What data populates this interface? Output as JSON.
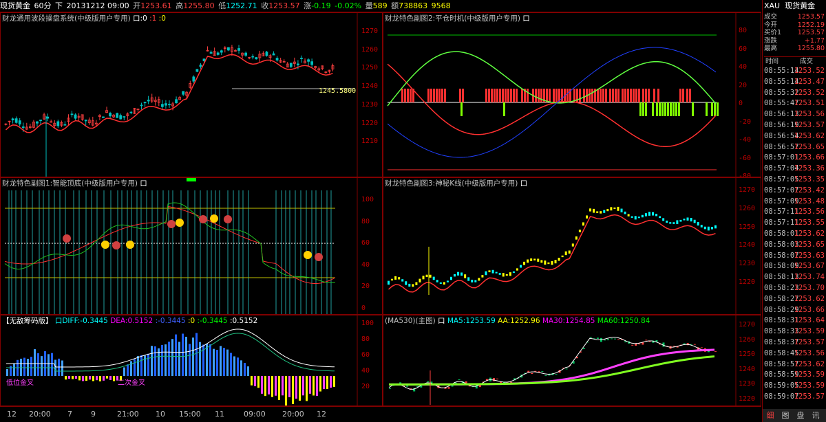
{
  "top": {
    "name": "现货黄金",
    "period": "60分",
    "mode": "下",
    "datetime": "20131212 09:00",
    "open_label": "开",
    "open": "1253.61",
    "high_label": "高",
    "high": "1255.80",
    "low_label": "低",
    "low": "1252.71",
    "close_label": "收",
    "close": "1253.57",
    "chg_label": "涨",
    "chg": "-0.19",
    "pct": "-0.02%",
    "vol_label": "量",
    "vol": "589",
    "amt_label": "额",
    "amt": "738863",
    "extra": "9568"
  },
  "panels": {
    "p1": {
      "title": "财龙通用波段操盘系统(中级版用户专用)",
      "t1": "口:0",
      "t2": ":1",
      "t3": ":0",
      "level": "1245.5800",
      "y": [
        "1270",
        "1260",
        "1250",
        "1240",
        "1230",
        "1220",
        "1210"
      ]
    },
    "p2": {
      "title": "财龙特色副图2:平仓时机(中级版用户专用)",
      "t1": "口",
      "y": [
        "80",
        "60",
        "40",
        "20",
        "0",
        "-20",
        "-40",
        "-60",
        "-80"
      ]
    },
    "p3": {
      "title": "财龙特色副图1:智能顶底(中级版用户专用)",
      "t1": "口",
      "y": [
        "100",
        "80",
        "60",
        "40",
        "20",
        "0"
      ]
    },
    "p4": {
      "title": "财龙特色副图3:神秘K线(中级版用户专用)",
      "t1": "口",
      "y": [
        "1270",
        "1260",
        "1250",
        "1240",
        "1230",
        "1220"
      ]
    },
    "p5": {
      "title": "【无敌筹码版】",
      "diff_label": "口DIFF:",
      "diff": "-0.3445",
      "dea_label": "DEA:",
      "dea": "0.5152",
      "x1": ":-0.3445",
      "x2": ":0",
      "x3": ":-0.3445",
      "x4": ":0.5152",
      "note1": "低位金叉",
      "note2": "二次金叉",
      "y": [
        "100",
        "80",
        "60",
        "40",
        "20"
      ]
    },
    "p6": {
      "title": "(MA530)(主图)",
      "t1": "口",
      "ma5_label": "MA5:",
      "ma5": "1253.59",
      "aa_label": "AA:",
      "aa": "1252.96",
      "ma30_label": "MA30:",
      "ma30": "1254.85",
      "ma60_label": "MA60:",
      "ma60": "1250.84",
      "y": [
        "1270",
        "1260",
        "1250",
        "1240",
        "1230",
        "1220"
      ]
    }
  },
  "xaxis": [
    "12",
    "20:00",
    "7",
    "9",
    "21:00",
    "10",
    "15:00",
    "11",
    "09:00",
    "20:00",
    "12"
  ],
  "side": {
    "symbol": "XAU",
    "name": "现货黄金",
    "rows": [
      {
        "k": "成交",
        "v": "1253.57"
      },
      {
        "k": "今开",
        "v": "1252.19"
      },
      {
        "k": "买价1",
        "v": "1253.57"
      },
      {
        "k": "涨跌",
        "v": "+1.77"
      },
      {
        "k": "最高",
        "v": "1255.80"
      }
    ],
    "col_time": "时间",
    "col_price": "成交",
    "ticks": [
      [
        "08:55:14",
        "1253.52"
      ],
      [
        "08:55:14",
        "1253.47"
      ],
      [
        "08:55:32",
        "1253.52"
      ],
      [
        "08:55:47",
        "1253.51"
      ],
      [
        "08:56:13",
        "1253.56"
      ],
      [
        "08:56:19",
        "1253.57"
      ],
      [
        "08:56:54",
        "1253.62"
      ],
      [
        "08:56:57",
        "1253.65"
      ],
      [
        "08:57:01",
        "1253.66"
      ],
      [
        "08:57:04",
        "1253.36"
      ],
      [
        "08:57:05",
        "1253.35"
      ],
      [
        "08:57:07",
        "1253.42"
      ],
      [
        "08:57:09",
        "1253.48"
      ],
      [
        "08:57:11",
        "1253.56"
      ],
      [
        "08:57:11",
        "1253.55"
      ],
      [
        "08:58:01",
        "1253.62"
      ],
      [
        "08:58:03",
        "1253.65"
      ],
      [
        "08:58:07",
        "1253.63"
      ],
      [
        "08:58:09",
        "1253.67"
      ],
      [
        "08:58:13",
        "1253.74"
      ],
      [
        "08:58:23",
        "1253.70"
      ],
      [
        "08:58:27",
        "1253.62"
      ],
      [
        "08:58:29",
        "1253.66"
      ],
      [
        "08:58:31",
        "1253.64"
      ],
      [
        "08:58:33",
        "1253.59"
      ],
      [
        "08:58:37",
        "1253.57"
      ],
      [
        "08:58:45",
        "1253.56"
      ],
      [
        "08:58:57",
        "1253.62"
      ],
      [
        "08:58:59",
        "1253.59"
      ],
      [
        "08:59:05",
        "1253.59"
      ],
      [
        "08:59:07",
        "1253.57"
      ]
    ],
    "buttons": [
      "细",
      "图",
      "盘",
      "讯"
    ]
  },
  "colors": {
    "up": "#ff4040",
    "down": "#00ffff",
    "frame": "#800000",
    "green": "#00ff00",
    "yellow": "#ffff00",
    "magenta": "#ff00ff"
  }
}
